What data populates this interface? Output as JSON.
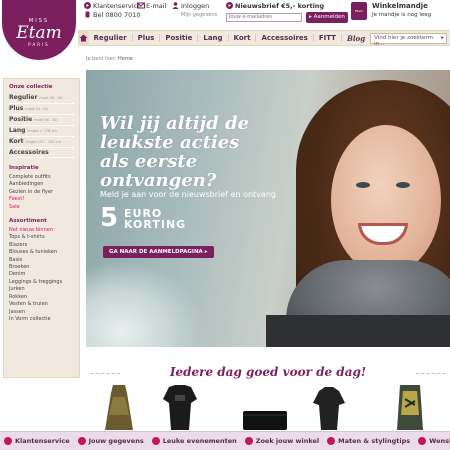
{
  "logo": {
    "miss": "MISS",
    "brand": "Etam",
    "paris": "PARIS"
  },
  "topbar": {
    "service": {
      "label": "Klantenservice",
      "phone": "Bel 0800 7010"
    },
    "email": {
      "label": "E-mail"
    },
    "login": {
      "label": "Inloggen",
      "sub": "Mijn gegevens"
    },
    "newsletter": {
      "label": "Nieuwsbrief €5,- korting",
      "placeholder": "Jouw e-mailadres",
      "button": "Aanmelden"
    },
    "cart": {
      "label": "Winkelmandje",
      "sub": "Je mandje is nog leeg",
      "bag_text": "Etam"
    }
  },
  "nav": {
    "items": [
      "Regulier",
      "Plus",
      "Positie",
      "Lang",
      "Kort",
      "Accessoires",
      "FITT",
      "Blog"
    ],
    "search_placeholder": "Vind hier je zoekterm in..."
  },
  "breadcrumb": {
    "prefix": "Je bent hier:",
    "current": "Home"
  },
  "sidebar": {
    "collection_title": "Onze collectie",
    "collection": [
      {
        "label": "Regulier",
        "size": "maat 36 - 46"
      },
      {
        "label": "Plus",
        "size": "maat 44 - 54"
      },
      {
        "label": "Positie",
        "size": "maat 36 - 48"
      },
      {
        "label": "Lang",
        "size": "lengte > 178 cm"
      },
      {
        "label": "Kort",
        "size": "lengte 157 - 164 cm"
      },
      {
        "label": "Accessoires",
        "size": ""
      }
    ],
    "inspiration_title": "Inspiratie",
    "inspiration": [
      "Complete outfits",
      "Aanbiedingen",
      "Gezien in de flyer",
      "Feest!",
      "Sale"
    ],
    "assortment_title": "Assortiment",
    "assortment": [
      "Net nieuw binnen",
      "Tops & t-shirts",
      "Blazers",
      "Blouses & tunieken",
      "Basis",
      "Broeken",
      "Denim",
      "Leggings & treggings",
      "Jurken",
      "Rokken",
      "Vesten & truien",
      "Jassen",
      "In Vorm collectie"
    ]
  },
  "hero": {
    "title": "Wil jij altijd de leukste acties als eerste ontvangen?",
    "subtitle": "Meld je aan voor de nieuwsbrief en ontvang",
    "amount": "5",
    "euro": "EURO",
    "korting": "KORTING",
    "cta": "GA NAAR DE AANMELDPAGINA"
  },
  "promo": {
    "title": "Iedere dag goed voor de dag!"
  },
  "footer": {
    "items": [
      "Klantenservice",
      "Jouw gegevens",
      "Leuke evenementen",
      "Zoek jouw winkel",
      "Maten & stylingtips",
      "Wenslijst"
    ]
  },
  "colors": {
    "brand": "#7b1f5f",
    "highlight": "#d01c6c",
    "sidebar_bg": "#f1e9dd"
  }
}
